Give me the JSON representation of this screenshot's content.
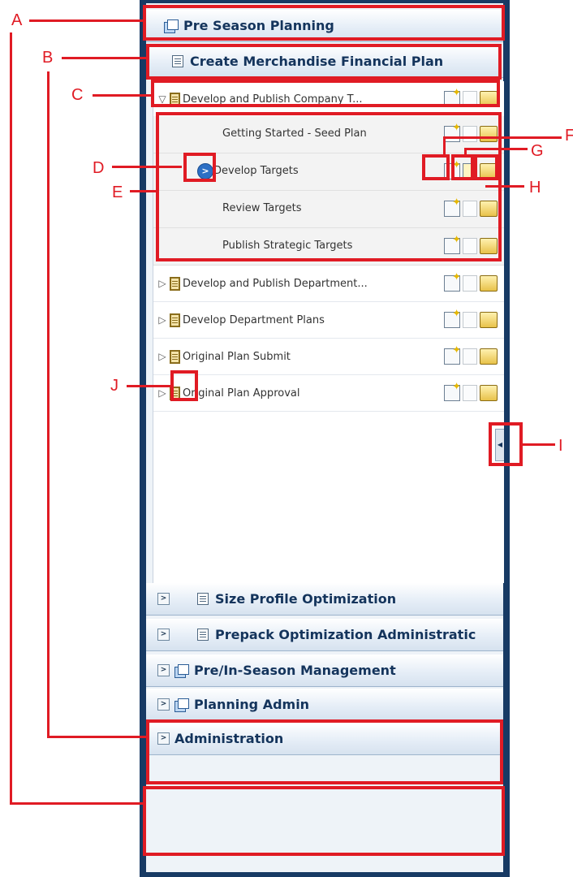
{
  "navigator": {
    "top_tasks": [
      {
        "label": "Pre Season Planning"
      }
    ],
    "sub_task": {
      "label": "Create Merchandise Financial Plan"
    },
    "activities": [
      {
        "label": "Develop and Publish Company T...",
        "expanded": true
      },
      {
        "label": "Develop and Publish Department...",
        "expanded": false
      },
      {
        "label": "Develop Department Plans",
        "expanded": false
      },
      {
        "label": "Original Plan Submit",
        "expanded": false
      },
      {
        "label": "Original Plan Approval",
        "expanded": false
      }
    ],
    "tasks": [
      {
        "label": "Getting Started - Seed Plan"
      },
      {
        "label": "Develop Targets",
        "current": true
      },
      {
        "label": "Review Targets"
      },
      {
        "label": "Publish Strategic Targets"
      }
    ],
    "bottom_sub_tasks": [
      {
        "label": "Size Profile Optimization"
      },
      {
        "label": "Prepack Optimization Administratic"
      }
    ],
    "bottom_tasks": [
      {
        "label": "Pre/In-Season Management"
      },
      {
        "label": "Planning Admin"
      },
      {
        "label": "Administration"
      }
    ],
    "icons": {
      "expanded_toggle": "▽",
      "collapsed_toggle": "▷",
      "chevron": ">",
      "current_task": ">",
      "collapse": "◀"
    }
  },
  "annotations": {
    "labels": [
      "A",
      "B",
      "C",
      "D",
      "E",
      "F",
      "G",
      "H",
      "I",
      "J"
    ],
    "color": "#e01b24"
  }
}
